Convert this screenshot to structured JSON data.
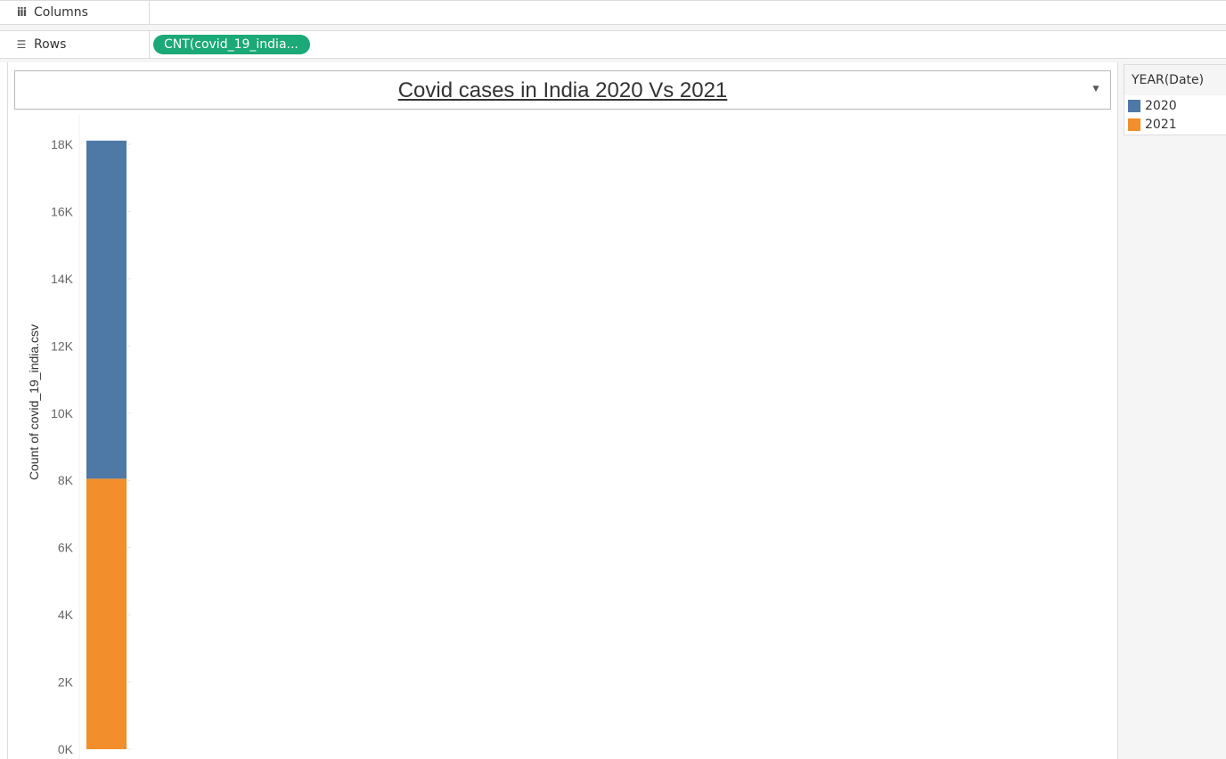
{
  "shelves": {
    "columns_label": "Columns",
    "rows_label": "Rows",
    "rows_pill": "CNT(covid_19_india..."
  },
  "chart_data": {
    "type": "bar",
    "stacked": true,
    "title": "Covid cases in India 2020 Vs 2021",
    "ylabel": "Count of covid_19_india.csv",
    "xlabel": "",
    "ylim": [
      0,
      18000
    ],
    "yticks": [
      0,
      2000,
      4000,
      6000,
      8000,
      10000,
      12000,
      14000,
      16000,
      18000
    ],
    "ytick_labels": [
      "0K",
      "2K",
      "4K",
      "6K",
      "8K",
      "10K",
      "12K",
      "14K",
      "16K",
      "18K"
    ],
    "categories": [
      ""
    ],
    "series": [
      {
        "name": "2021",
        "values": [
          8050
        ],
        "color": "#f28e2b"
      },
      {
        "name": "2020",
        "values": [
          10060
        ],
        "color": "#4e79a7"
      }
    ],
    "grid": false,
    "legend_placement": "right"
  },
  "legend": {
    "title": "YEAR(Date)",
    "items": [
      {
        "label": "2020",
        "color": "#4e79a7"
      },
      {
        "label": "2021",
        "color": "#f28e2b"
      }
    ]
  },
  "icons": {
    "columns": "columns-icon",
    "rows": "rows-icon",
    "dropdown": "dropdown-caret-icon"
  }
}
